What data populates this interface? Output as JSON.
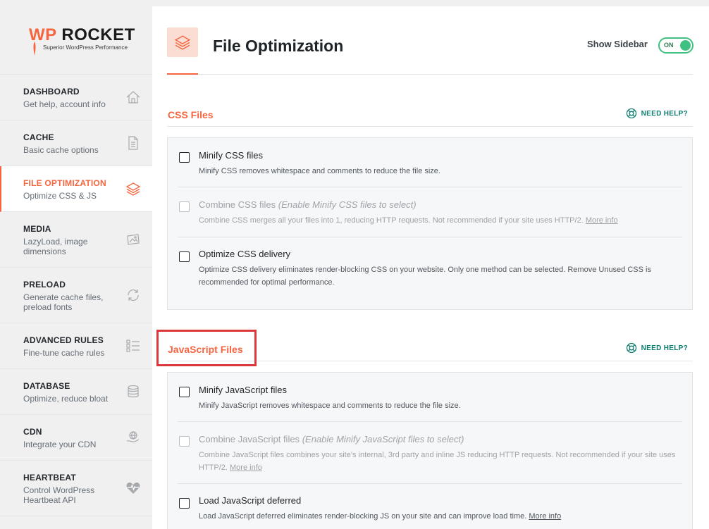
{
  "logo": {
    "brand_wp": "WP",
    "brand_rocket": "ROCKET",
    "tagline": "Superior WordPress Performance"
  },
  "nav": [
    {
      "title": "DASHBOARD",
      "sub": "Get help, account info",
      "icon": "home-icon"
    },
    {
      "title": "CACHE",
      "sub": "Basic cache options",
      "icon": "document-icon"
    },
    {
      "title": "FILE OPTIMIZATION",
      "sub": "Optimize CSS & JS",
      "icon": "layers-icon",
      "active": true
    },
    {
      "title": "MEDIA",
      "sub": "LazyLoad, image dimensions",
      "icon": "image-icon"
    },
    {
      "title": "PRELOAD",
      "sub": "Generate cache files, preload fonts",
      "icon": "refresh-icon"
    },
    {
      "title": "ADVANCED RULES",
      "sub": "Fine-tune cache rules",
      "icon": "checklist-icon"
    },
    {
      "title": "DATABASE",
      "sub": "Optimize, reduce bloat",
      "icon": "database-icon"
    },
    {
      "title": "CDN",
      "sub": "Integrate your CDN",
      "icon": "globe-hand-icon"
    },
    {
      "title": "HEARTBEAT",
      "sub": "Control WordPress Heartbeat API",
      "icon": "heartbeat-icon"
    }
  ],
  "header": {
    "title": "File Optimization",
    "sidebar_label": "Show Sidebar",
    "toggle_label": "ON"
  },
  "help_label": "NEED HELP?",
  "css": {
    "title": "CSS Files",
    "fields": [
      {
        "label": "Minify CSS files",
        "desc": "Minify CSS removes whitespace and comments to reduce the file size."
      },
      {
        "label": "Combine CSS files",
        "label_note": "(Enable Minify CSS files to select)",
        "desc": "Combine CSS merges all your files into 1, reducing HTTP requests. Not recommended if your site uses HTTP/2.",
        "more": "More info"
      },
      {
        "label": "Optimize CSS delivery",
        "desc": "Optimize CSS delivery eliminates render-blocking CSS on your website. Only one method can be selected. Remove Unused CSS is recommended for optimal performance."
      }
    ]
  },
  "js": {
    "title": "JavaScript Files",
    "fields": [
      {
        "label": "Minify JavaScript files",
        "desc": "Minify JavaScript removes whitespace and comments to reduce the file size."
      },
      {
        "label": "Combine JavaScript files",
        "label_note": "(Enable Minify JavaScript files to select)",
        "desc": "Combine JavaScript files combines your site’s internal, 3rd party and inline JS reducing HTTP requests. Not recommended if your site uses HTTP/2.",
        "more": "More info"
      },
      {
        "label": "Load JavaScript deferred",
        "desc": "Load JavaScript deferred eliminates render-blocking JS on your site and can improve load time.",
        "more": "More info"
      }
    ]
  },
  "colors": {
    "accent": "#f56640",
    "toggle_on": "#3fc181",
    "help": "#0f7c70",
    "highlight": "#d9393a"
  }
}
